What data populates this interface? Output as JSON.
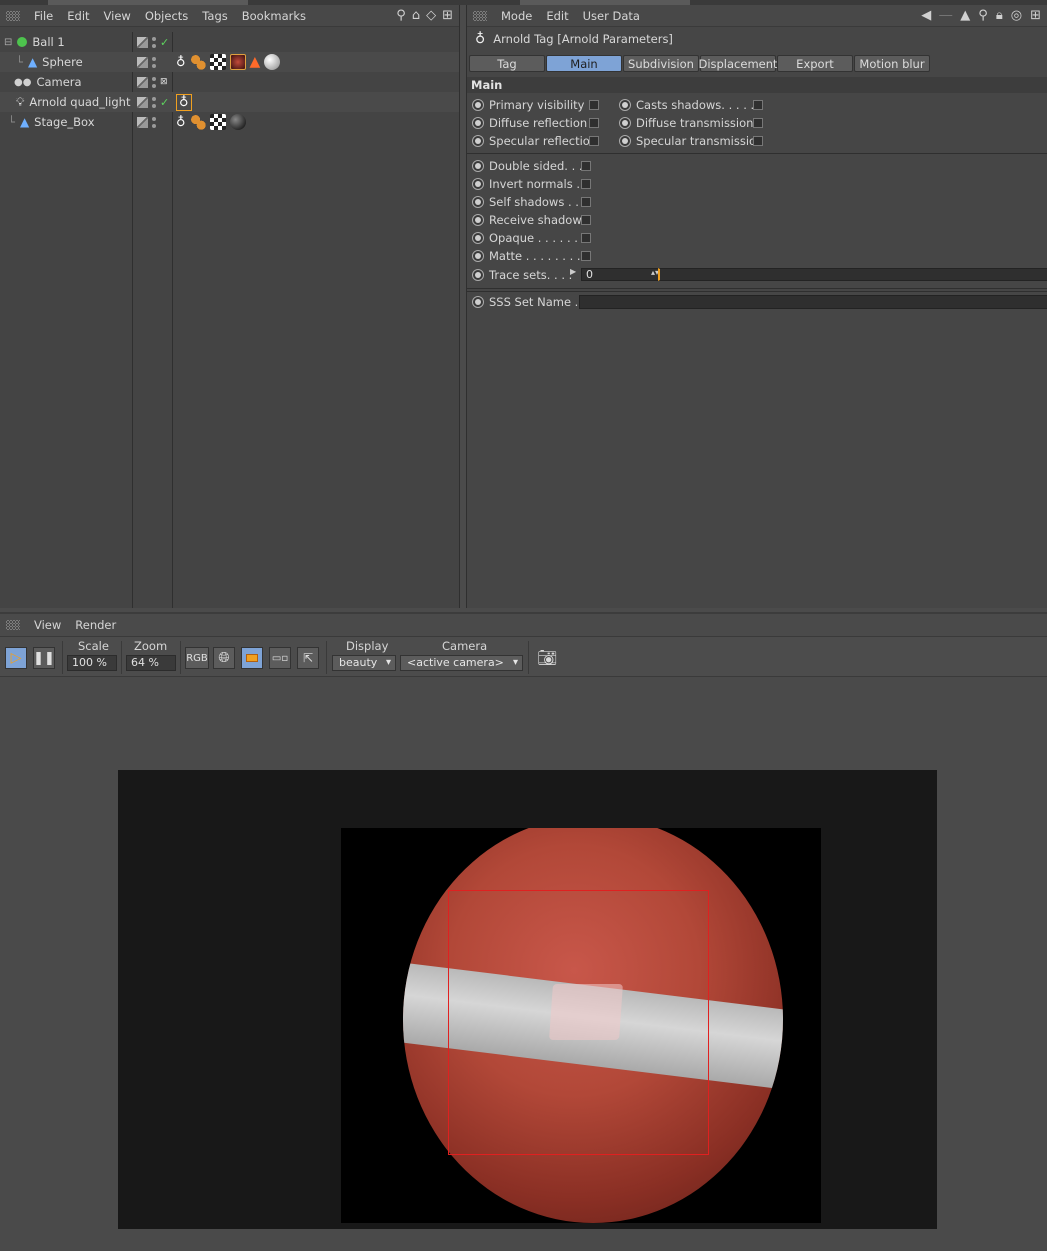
{
  "objmgr": {
    "menu": [
      "File",
      "Edit",
      "View",
      "Objects",
      "Tags",
      "Bookmarks"
    ],
    "objects": [
      {
        "name": "Ball 1",
        "color": "#4dc34d",
        "tags": []
      },
      {
        "name": "Sphere",
        "color": "#6fb0ff",
        "tags": [
          "arnold-tag-icon",
          "sphere-dots-icon",
          "checker-texture-icon",
          "material-red-icon",
          "cone-orange-icon",
          "material-gray-icon"
        ]
      },
      {
        "name": "Camera",
        "color": "#cfcfcf",
        "tags": []
      },
      {
        "name": "Arnold quad_light",
        "color": "#cfcfcf",
        "tags": [
          "arnold-tag-icon"
        ]
      },
      {
        "name": "Stage_Box",
        "color": "#6fb0ff",
        "tags": [
          "arnold-tag-icon",
          "sphere-dots-icon",
          "checker-texture-icon",
          "material-black-icon"
        ]
      }
    ]
  },
  "attr": {
    "menu": [
      "Mode",
      "Edit",
      "User Data"
    ],
    "title": "Arnold Tag [Arnold Parameters]",
    "tabs": [
      "Tag",
      "Main",
      "Subdivision",
      "Displacement",
      "Export",
      "Motion blur"
    ],
    "active_tab": "Main",
    "section": "Main",
    "left_params": [
      "Primary visibility .",
      "Diffuse reflection",
      "Specular reflection"
    ],
    "right_params": [
      "Casts shadows. . . . . .",
      "Diffuse transmission",
      "Specular transmission"
    ],
    "params2": [
      "Double sided. . .",
      "Invert normals . .",
      "Self shadows . . .",
      "Receive shadows",
      "Opaque . . . . . . .",
      "Matte . . . . . . . . ."
    ],
    "trace_label": "Trace sets. . . .",
    "trace_value": "0",
    "sss_label": "SSS Set Name . ."
  },
  "render": {
    "menu": [
      "View",
      "Render"
    ],
    "scale_label": "Scale",
    "scale_value": "100 %",
    "zoom_label": "Zoom",
    "zoom_value": "64 %",
    "rgb_label": "RGB",
    "display_label": "Display",
    "display_value": "beauty",
    "camera_label": "Camera",
    "camera_value": "<active camera>"
  }
}
